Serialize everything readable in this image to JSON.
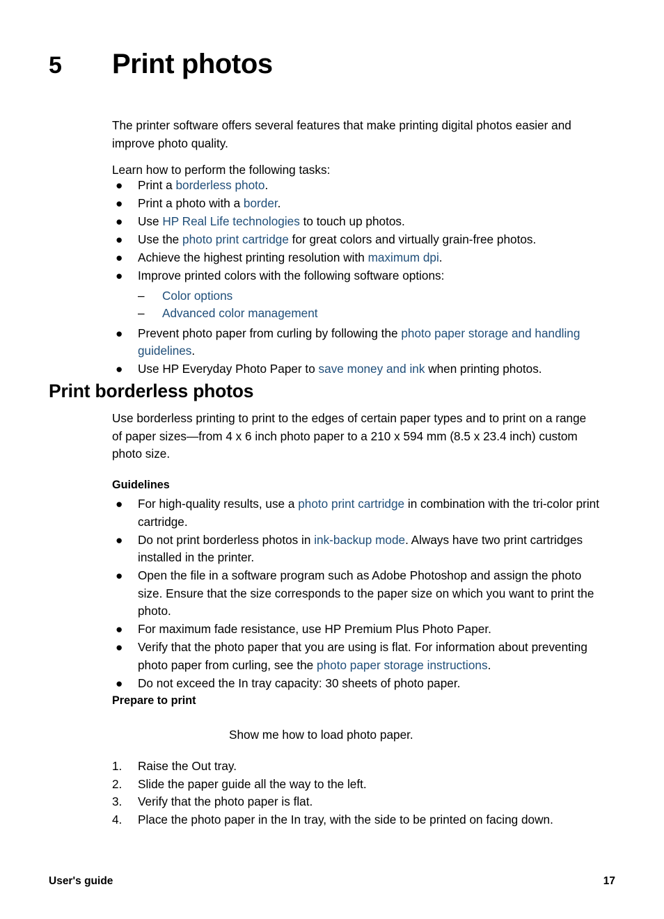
{
  "chapter": {
    "number": "5",
    "title": "Print photos"
  },
  "intro": {
    "paragraph1": "The printer software offers several features that make printing digital photos easier and improve photo quality.",
    "paragraph2": "Learn how to perform the following tasks:"
  },
  "task_list": {
    "bullet_marker": "●",
    "dash_marker": "–",
    "items": [
      {
        "pre": "Print a ",
        "link": "borderless photo",
        "post": "."
      },
      {
        "pre": "Print a photo with a ",
        "link": "border",
        "post": "."
      },
      {
        "pre": "Use ",
        "link": "HP Real Life technologies",
        "post": " to touch up photos."
      },
      {
        "pre": "Use the ",
        "link": "photo print cartridge",
        "post": " for great colors and virtually grain-free photos."
      },
      {
        "pre": "Achieve the highest printing resolution with ",
        "link": "maximum dpi",
        "post": "."
      },
      {
        "pre": "Improve printed colors with the following software options:",
        "link": "",
        "post": ""
      },
      {
        "pre": "Prevent photo paper from curling by following the ",
        "link": "photo paper storage and handling guidelines",
        "post": "."
      },
      {
        "pre": "Use HP Everyday Photo Paper to ",
        "link": "save money and ink",
        "post": " when printing photos."
      }
    ],
    "sub_items": [
      {
        "link": "Color options"
      },
      {
        "link": "Advanced color management"
      }
    ]
  },
  "section": {
    "title": "Print borderless photos",
    "intro": "Use borderless printing to print to the edges of certain paper types and to print on a range of paper sizes—from 4 x 6 inch photo paper to a 210 x 594 mm (8.5 x 23.4 inch) custom photo size."
  },
  "guidelines": {
    "heading": "Guidelines",
    "items": [
      {
        "pre": "For high-quality results, use a ",
        "link": "photo print cartridge",
        "post": " in combination with the tri-color print cartridge."
      },
      {
        "pre": "Do not print borderless photos in ",
        "link": "ink-backup mode",
        "post": ". Always have two print cartridges installed in the printer."
      },
      {
        "pre": "Open the file in a software program such as Adobe Photoshop and assign the photo size. Ensure that the size corresponds to the paper size on which you want to print the photo.",
        "link": "",
        "post": ""
      },
      {
        "pre": "For maximum fade resistance, use HP Premium Plus Photo Paper.",
        "link": "",
        "post": ""
      },
      {
        "pre": "Verify that the photo paper that you are using is flat. For information about preventing photo paper from curling, see the ",
        "link": "photo paper storage instructions",
        "post": "."
      },
      {
        "pre": "Do not exceed the In tray capacity: 30 sheets of photo paper.",
        "link": "",
        "post": ""
      }
    ]
  },
  "prepare": {
    "heading": "Prepare to print",
    "note": "Show me how to load photo paper.",
    "steps": [
      {
        "num": "1.",
        "text": "Raise the Out tray."
      },
      {
        "num": "2.",
        "text": "Slide the paper guide all the way to the left."
      },
      {
        "num": "3.",
        "text": "Verify that the photo paper is flat."
      },
      {
        "num": "4.",
        "text": "Place the photo paper in the In tray, with the side to be printed on facing down."
      }
    ]
  },
  "footer": {
    "left": "User's guide",
    "page_number": "17"
  },
  "colors": {
    "link": "#1f4e79",
    "text": "#000000",
    "background": "#ffffff"
  }
}
